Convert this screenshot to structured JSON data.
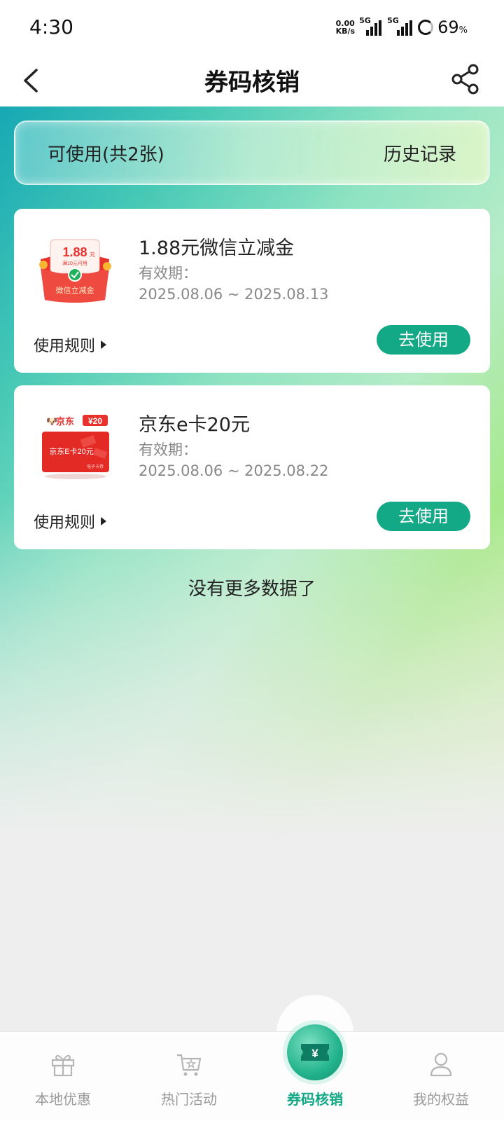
{
  "status_bar": {
    "time": "4:30",
    "net_speed_value": "0.00",
    "net_speed_unit": "KB/s",
    "signal1_label": "5G",
    "signal2_label": "5G",
    "battery_value": "69",
    "battery_unit": "%"
  },
  "nav": {
    "title": "券码核销",
    "back_icon": "chevron-left-icon",
    "share_icon": "share-icon"
  },
  "tabs": {
    "available": "可使用(共2张)",
    "history": "历史记录"
  },
  "coupons": [
    {
      "title": "1.88元微信立减金",
      "validity_label": "有效期：",
      "validity": "2025.08.06 ~ 2025.08.13",
      "rules_label": "使用规则",
      "action_label": "去使用",
      "thumb": {
        "amount": "1.88",
        "amount_unit": "元",
        "condition": "满10元可用",
        "name": "微信立减金"
      }
    },
    {
      "title": "京东e卡20元",
      "validity_label": "有效期：",
      "validity": "2025.08.06 ~ 2025.08.22",
      "rules_label": "使用规则",
      "action_label": "去使用",
      "thumb": {
        "brand": "京东",
        "badge": "¥20",
        "name": "京东E卡20元",
        "sub": "电子卡券"
      }
    }
  ],
  "footer_text": "没有更多数据了",
  "bottom_nav": [
    {
      "label": "本地优惠",
      "icon": "gift-icon",
      "active": false
    },
    {
      "label": "热门活动",
      "icon": "cart-icon",
      "active": false
    },
    {
      "label": "券码核销",
      "icon": "ticket-icon",
      "active": true
    },
    {
      "label": "我的权益",
      "icon": "user-icon",
      "active": false
    }
  ],
  "colors": {
    "accent": "#13a886",
    "voucher_red": "#e8322e"
  }
}
